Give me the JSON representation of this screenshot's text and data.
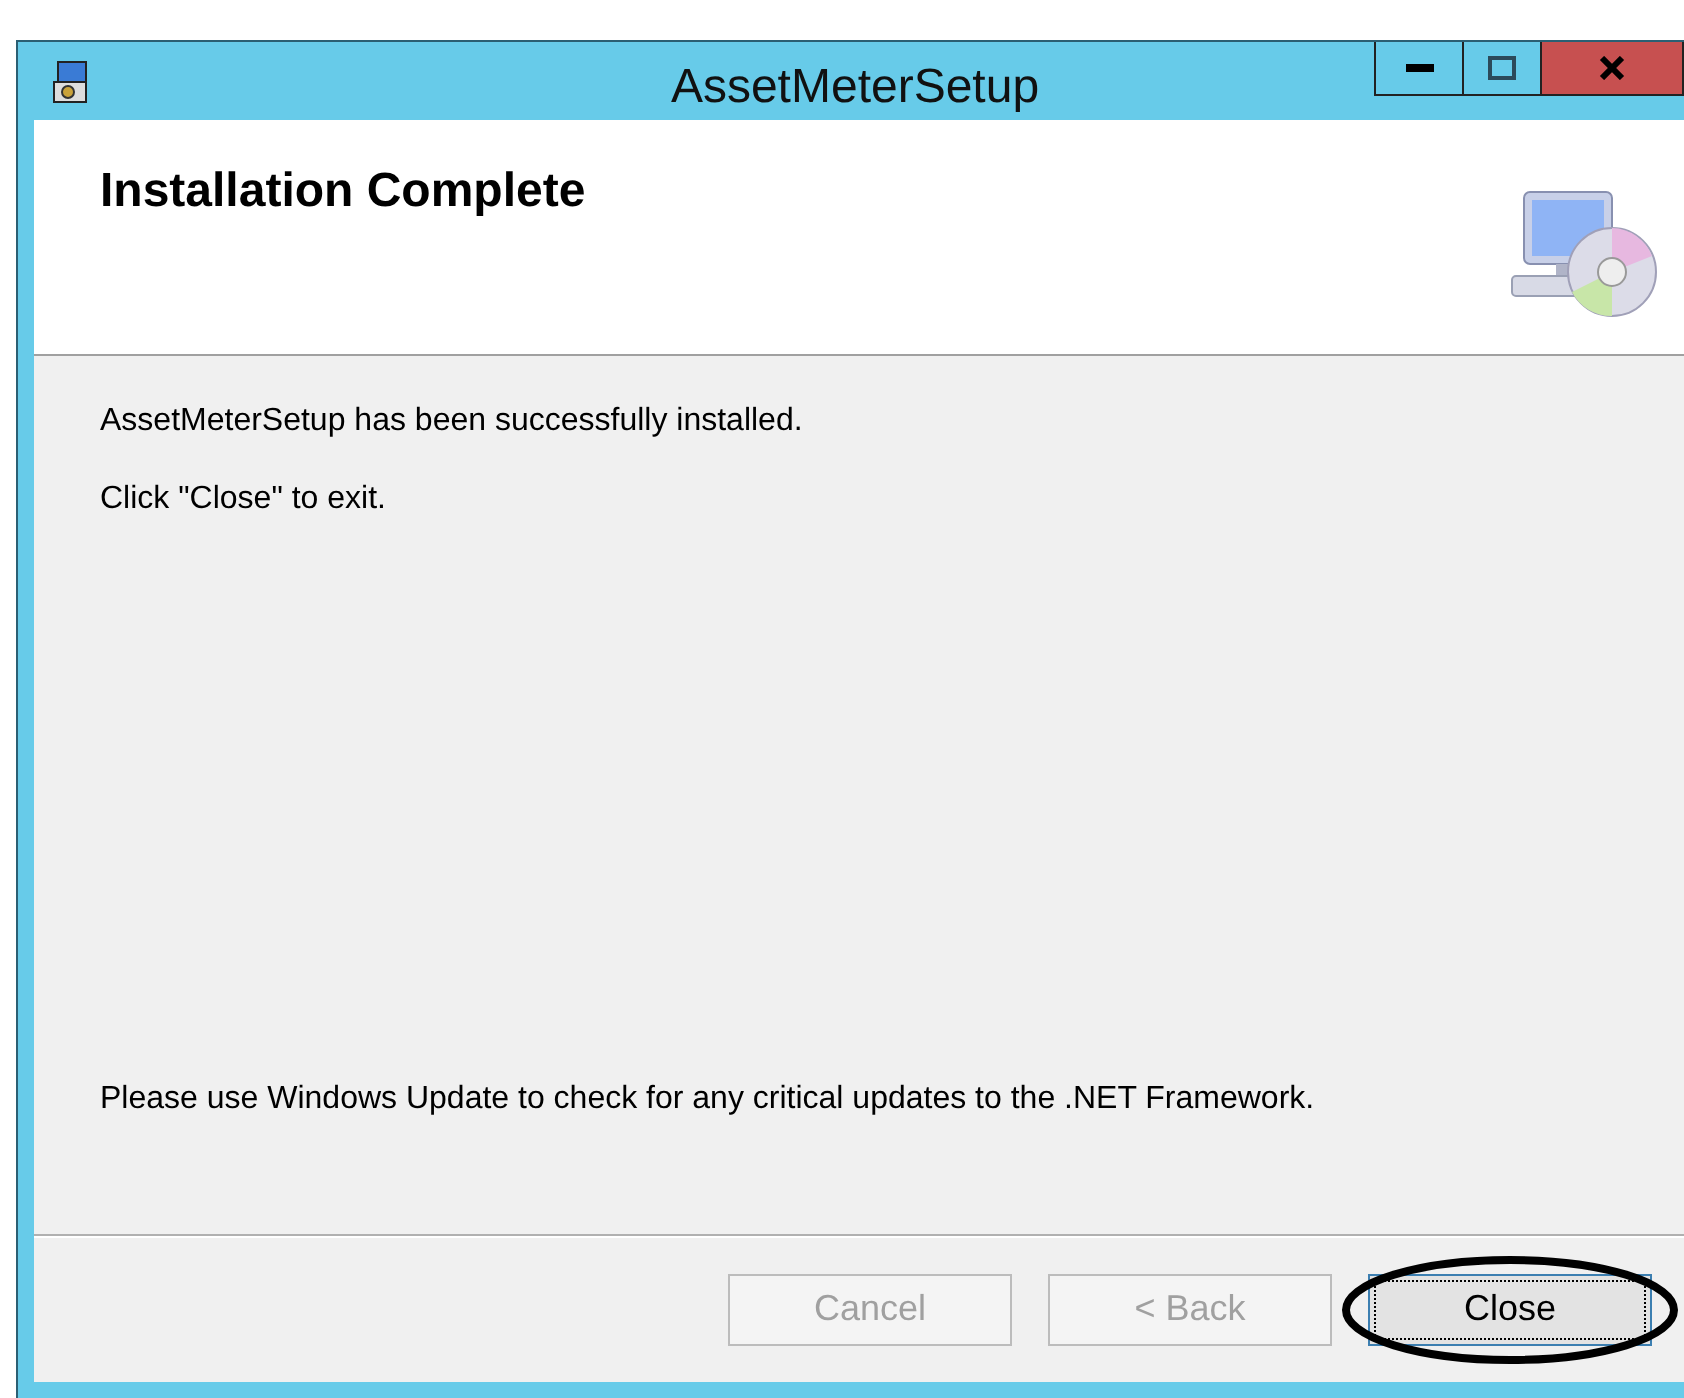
{
  "window": {
    "title": "AssetMeterSetup"
  },
  "header": {
    "title": "Installation Complete"
  },
  "messages": [
    "AssetMeterSetup has been successfully installed.",
    "Click \"Close\" to exit."
  ],
  "footer_note": "Please use Windows Update to check for any critical updates to the .NET Framework.",
  "buttons": [
    {
      "label": "Cancel",
      "disabled": true,
      "focused": false,
      "circled": false
    },
    {
      "label": "< Back",
      "disabled": true,
      "focused": false,
      "circled": false
    },
    {
      "label": "Close",
      "disabled": false,
      "focused": true,
      "circled": true
    }
  ]
}
